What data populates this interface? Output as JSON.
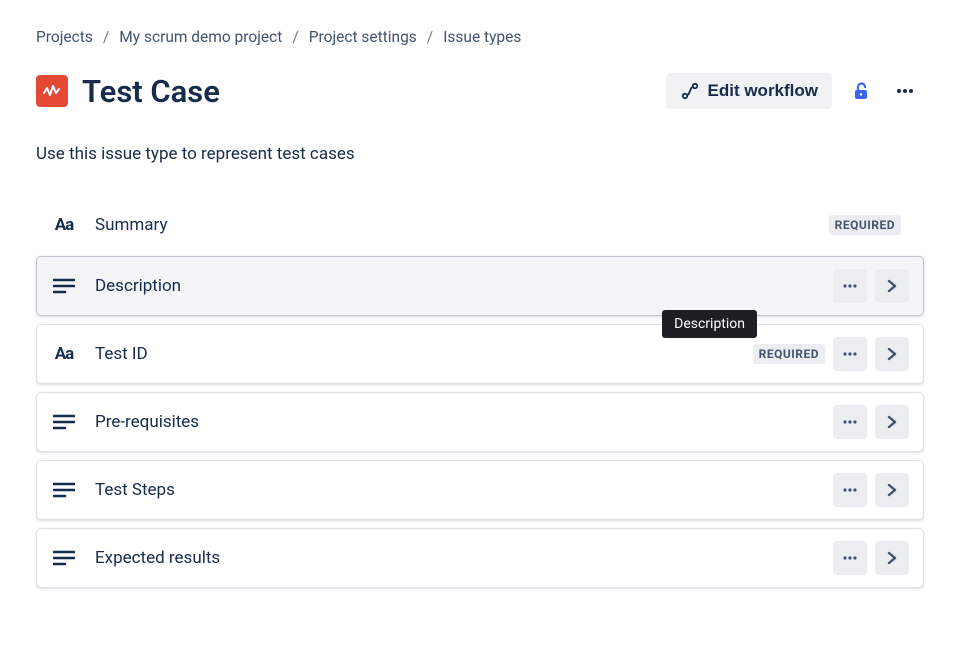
{
  "breadcrumb": {
    "items": [
      "Projects",
      "My scrum demo project",
      "Project settings",
      "Issue types"
    ]
  },
  "header": {
    "title": "Test Case",
    "edit_workflow_label": "Edit workflow"
  },
  "description": "Use this issue type to represent test cases",
  "required_label": "REQUIRED",
  "tooltip": "Description",
  "fields": [
    {
      "name": "Summary",
      "icon": "text",
      "required": true,
      "actions": false,
      "selected": false,
      "first": true
    },
    {
      "name": "Description",
      "icon": "paragraph",
      "required": false,
      "actions": true,
      "selected": true,
      "tooltip": true
    },
    {
      "name": "Test ID",
      "icon": "text",
      "required": true,
      "actions": true,
      "selected": false
    },
    {
      "name": "Pre-requisites",
      "icon": "paragraph",
      "required": false,
      "actions": true,
      "selected": false
    },
    {
      "name": "Test Steps",
      "icon": "paragraph",
      "required": false,
      "actions": true,
      "selected": false
    },
    {
      "name": "Expected results",
      "icon": "paragraph",
      "required": false,
      "actions": true,
      "selected": false
    }
  ]
}
